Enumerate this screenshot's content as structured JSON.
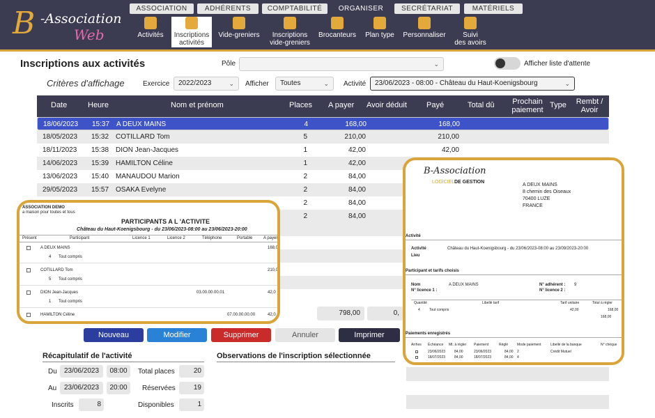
{
  "app": {
    "logo_b": "B",
    "logo_t1": "-Association",
    "logo_t2": "Web"
  },
  "tabs": [
    "ASSOCIATION",
    "ADHÉRENTS",
    "COMPTABILITÉ",
    "ORGANISER",
    "SECRÉTARIAT",
    "MATÉRIELS"
  ],
  "tools": [
    {
      "l1": "Activités",
      "l2": ""
    },
    {
      "l1": "Inscriptions",
      "l2": "activités"
    },
    {
      "l1": "Vide-greniers",
      "l2": ""
    },
    {
      "l1": "Inscriptions",
      "l2": "vide-greniers"
    },
    {
      "l1": "Brocanteurs",
      "l2": ""
    },
    {
      "l1": "Plan type",
      "l2": ""
    },
    {
      "l1": "Personnaliser",
      "l2": ""
    },
    {
      "l1": "Suivi",
      "l2": "des avoirs"
    }
  ],
  "page": {
    "title": "Inscriptions aux activités",
    "pole_label": "Pôle",
    "pole_value": "",
    "waitlist_label": "Afficher liste d'attente",
    "criteres": "Critères d'affichage",
    "exercice_label": "Exercice",
    "exercice_value": "2022/2023",
    "afficher_label": "Afficher",
    "afficher_value": "Toutes",
    "activite_label": "Activité",
    "activite_value": "23/06/2023 - 08:00 - Château du Haut-Koenigsbourg"
  },
  "table": {
    "headers": [
      "Date",
      "Heure",
      "Nom et prénom",
      "Places",
      "A payer",
      "Avoir déduit",
      "Payé",
      "Total dû",
      "Prochain paiement",
      "Type",
      "Rembt / Avoir"
    ],
    "rows": [
      {
        "date": "18/06/2023",
        "heure": "15:37",
        "nom": "A DEUX MAINS",
        "places": "4",
        "apayer": "168,00",
        "paye": "168,00"
      },
      {
        "date": "18/05/2023",
        "heure": "15:32",
        "nom": "COTILLARD Tom",
        "places": "5",
        "apayer": "210,00",
        "paye": "210,00"
      },
      {
        "date": "18/11/2023",
        "heure": "15:38",
        "nom": "DION Jean-Jacques",
        "places": "1",
        "apayer": "42,00",
        "paye": "42,00"
      },
      {
        "date": "14/06/2023",
        "heure": "15:39",
        "nom": "HAMILTON Céline",
        "places": "1",
        "apayer": "42,00",
        "paye": ""
      },
      {
        "date": "13/06/2023",
        "heure": "15:40",
        "nom": "MANAUDOU Marion",
        "places": "2",
        "apayer": "84,00",
        "paye": ""
      },
      {
        "date": "29/05/2023",
        "heure": "15:57",
        "nom": "OSAKA Evelyne",
        "places": "2",
        "apayer": "84,00",
        "paye": ""
      },
      {
        "date": "",
        "heure": "",
        "nom": "",
        "places": "2",
        "apayer": "84,00",
        "paye": ""
      },
      {
        "date": "",
        "heure": "",
        "nom": "",
        "places": "2",
        "apayer": "84,00",
        "paye": ""
      }
    ],
    "total_apayer": "798,00",
    "total_avoir": "0,"
  },
  "overlay1": {
    "org": "ASSOCIATION DEMO",
    "org2": "a maison pour toutes et tous",
    "title": "PARTICIPANTS A L 'ACTIVITE",
    "subtitle": "Château du Haut-Koenigsbourg  -  du 23/06/2023-08:00 au 23/06/2023-20:00",
    "cols": [
      "Présent",
      "Participant",
      "Licence 1",
      "Licence 2",
      "Téléphone",
      "Portable",
      "A payer"
    ],
    "entries": [
      {
        "name": "A DEUX MAINS",
        "qty": "4",
        "tarif": "Tout compris",
        "tel": "",
        "port": "",
        "amt": "168,0"
      },
      {
        "name": "COTILLARD Tom",
        "qty": "5",
        "tarif": "Tout compris",
        "tel": "",
        "port": "",
        "amt": "210,0"
      },
      {
        "name": "DION Jean-Jacques",
        "qty": "1",
        "tarif": "Tout compris",
        "tel": "03.00.00.00.01",
        "port": "",
        "amt": "42,0"
      },
      {
        "name": "HAMILTON Céline",
        "qty": "1",
        "tarif": "Tout compris",
        "tel": "",
        "port": "07.00.00.00.00",
        "amt": "42,0"
      }
    ]
  },
  "overlay2": {
    "logo1": "B-Association",
    "logo2": "LOGICIEL",
    "logo3": "DE GESTION",
    "addr": [
      "A DEUX MAINS",
      "8 chemin des Oiseaux",
      "70400 LUZE",
      "FRANCE"
    ],
    "sec_activite": "Activité",
    "activite_lbl": "Activité",
    "lieu_lbl": "Lieu",
    "activite_val": "Château du Haut-Koenigsbourg - du 23/06/2023-08:00 au 23/09/2023-20:00",
    "sec_participant": "Participant et tarifs choisis",
    "nom_lbl": "Nom",
    "nom_val": "A DEUX MAINS",
    "lic1_lbl": "N° licence 1 :",
    "adh_lbl": "N° adhérent :",
    "adh_val": "9",
    "lic2_lbl": "N° licence 2 :",
    "tarif_cols": [
      "Quantité",
      "Libellé tarif",
      "Tarif unitaire",
      "Total à régler"
    ],
    "tarif_row": [
      "4",
      "Tout compris",
      "42,00",
      "168,00"
    ],
    "tarif_total": "168,00",
    "sec_paiements": "Paiements enregistrés",
    "pay_cols": [
      "Arrhes",
      "Échéance",
      "Mt. à régler",
      "Paiement",
      "Réglé",
      "Mode paiement",
      "Libellé de la banque",
      "N° chèque"
    ],
    "pay_rows": [
      [
        "23/06/2023",
        "84,00",
        "23/06/2023",
        "84,00",
        "2",
        "Crédit Mutuel"
      ],
      [
        "18/07/2023",
        "84,00",
        "18/07/2023",
        "84,00",
        "4",
        ""
      ]
    ]
  },
  "buttons": {
    "nouveau": "Nouveau",
    "modifier": "Modifier",
    "supprimer": "Supprimer",
    "annuler": "Annuler",
    "imprimer": "Imprimer"
  },
  "summary": {
    "title": "Récapitulatif de l'activité",
    "du_lbl": "Du",
    "du_date": "23/06/2023",
    "du_time": "08:00",
    "au_lbl": "Au",
    "au_date": "23/06/2023",
    "au_time": "20:00",
    "inscrits_lbl": "Inscrits",
    "inscrits_val": "8",
    "total_places_lbl": "Total places",
    "total_places_val": "20",
    "reservees_lbl": "Réservées",
    "reservees_val": "19",
    "disponibles_lbl": "Disponibles",
    "disponibles_val": "1"
  },
  "observations": {
    "title": "Observations de l'inscription sélectionnée"
  },
  "colors": {
    "header": "#3b3b52",
    "gold": "#d9a53a",
    "selected": "#3f53c8",
    "nouveau": "#2b3ea0",
    "modifier": "#2a82d6",
    "supprimer": "#c92a2a",
    "imprimer": "#2d2d44"
  }
}
